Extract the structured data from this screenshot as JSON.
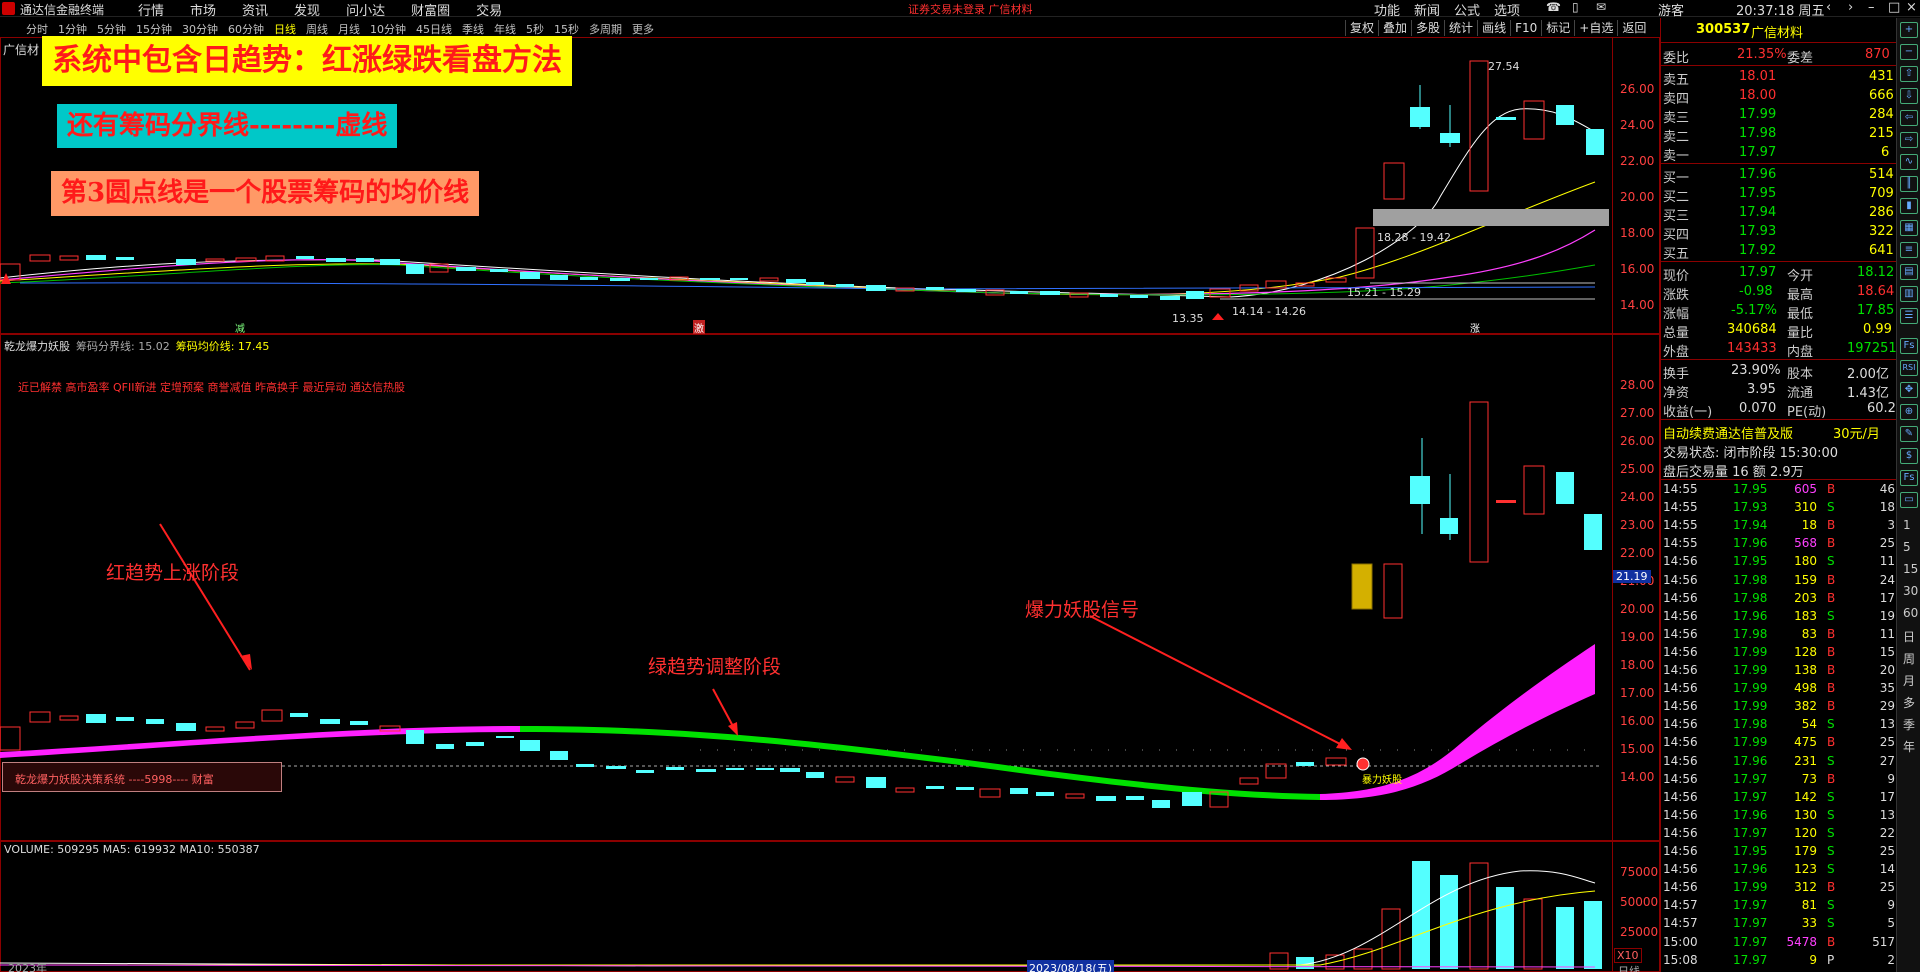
{
  "app": {
    "title": "通达信金融终端",
    "menu": [
      "行情",
      "市场",
      "资讯",
      "发现",
      "问小达",
      "财富圈",
      "交易"
    ],
    "alert": "证券交易未登录  广信材料",
    "right_menu": [
      "功能",
      "新闻",
      "公式",
      "选项"
    ],
    "guest": "游客",
    "clock": "20:37:18 周五"
  },
  "periods": [
    "分时",
    "1分钟",
    "5分钟",
    "15分钟",
    "30分钟",
    "60分钟",
    "日线",
    "周线",
    "月线",
    "10分钟",
    "45日线",
    "季线",
    "年线",
    "5秒",
    "15秒",
    "多周期",
    "更多"
  ],
  "active_period": "日线",
  "tool_buttons": [
    "复权",
    "叠加",
    "多股",
    "统计",
    "画线",
    "F10",
    "标记",
    "+自选",
    "返回"
  ],
  "banners": {
    "b1": "系统中包含日趋势：红涨绿跌看盘方法",
    "b2": "还有筹码分界线--------虚线",
    "b3": "第3圆点线是一个股票筹码的均价线"
  },
  "main_chart": {
    "stock_label": "广信材",
    "y_ticks": [
      "26.00",
      "24.00",
      "22.00",
      "20.00",
      "18.00",
      "16.00",
      "14.00"
    ],
    "high_mark": "27.54",
    "low_mark": "13.35",
    "range1": "18.28 - 19.42",
    "range2": "15.21 - 15.29",
    "range3": "14.14 - 14.26",
    "mark_jian": "减",
    "mark_ji": "激",
    "mark_zhang": "涨"
  },
  "ind_chart": {
    "header_name": "乾龙爆力妖股",
    "header_f1": "筹码分界线: 15.02",
    "header_f2": "筹码均价线: 17.45",
    "tags": "近已解禁 高市盈率 QFII新进 定增预案 商誉减值 昨高换手 最近异动 通达信热股",
    "y_ticks": [
      "28.00",
      "27.00",
      "26.00",
      "25.00",
      "24.00",
      "23.00",
      "22.00",
      "21.00",
      "20.00",
      "19.00",
      "18.00",
      "17.00",
      "16.00",
      "15.00",
      "14.00"
    ],
    "cur_price": "21.19",
    "ann1": "红趋势上涨阶段",
    "ann2": "绿趋势调整阶段",
    "ann3": "爆力妖股信号",
    "signal_label": "暴力妖股",
    "sys_box": "乾龙爆力妖股决策系统    ----5998---- 财富"
  },
  "volume": {
    "header": "VOLUME: 509295  MA5: 619932  MA10: 550387",
    "y_ticks": [
      "75000",
      "50000",
      "25000"
    ],
    "unit": "X10",
    "date_left": "2023年",
    "date_mid": "2023/08/18(五)",
    "date_right": "日线"
  },
  "quote": {
    "code": "300537",
    "name": "广信材料",
    "weibi_label": "委比",
    "weibi": "21.35%",
    "weicha_label": "委差",
    "weicha": "870",
    "asks": [
      {
        "label": "卖五",
        "price": "18.01",
        "vol": "431"
      },
      {
        "label": "卖四",
        "price": "18.00",
        "vol": "666"
      },
      {
        "label": "卖三",
        "price": "17.99",
        "vol": "284"
      },
      {
        "label": "卖二",
        "price": "17.98",
        "vol": "215"
      },
      {
        "label": "卖一",
        "price": "17.97",
        "vol": "6"
      }
    ],
    "bids": [
      {
        "label": "买一",
        "price": "17.96",
        "vol": "514"
      },
      {
        "label": "买二",
        "price": "17.95",
        "vol": "709"
      },
      {
        "label": "买三",
        "price": "17.94",
        "vol": "286"
      },
      {
        "label": "买四",
        "price": "17.93",
        "vol": "322"
      },
      {
        "label": "买五",
        "price": "17.92",
        "vol": "641"
      }
    ],
    "stats": [
      {
        "l1": "现价",
        "v1": "17.97",
        "l2": "今开",
        "v2": "18.12",
        "c1": "#00e000",
        "c2": "#00e000"
      },
      {
        "l1": "涨跌",
        "v1": "-0.98",
        "l2": "最高",
        "v2": "18.64",
        "c1": "#00e000",
        "c2": "#ff3030"
      },
      {
        "l1": "涨幅",
        "v1": "-5.17%",
        "l2": "最低",
        "v2": "17.85",
        "c1": "#00e000",
        "c2": "#00e000"
      },
      {
        "l1": "总量",
        "v1": "340684",
        "l2": "量比",
        "v2": "0.99",
        "c1": "#ffff00",
        "c2": "#ffff00"
      },
      {
        "l1": "外盘",
        "v1": "143433",
        "l2": "内盘",
        "v2": "197251",
        "c1": "#ff3030",
        "c2": "#00e000"
      }
    ],
    "fund": [
      {
        "l1": "换手",
        "v1": "23.90%",
        "l2": "股本",
        "v2": "2.00亿"
      },
      {
        "l1": "净资",
        "v1": "3.95",
        "l2": "流通",
        "v2": "1.43亿"
      },
      {
        "l1": "收益(一)",
        "v1": "0.070",
        "l2": "PE(动)",
        "v2": "60.2"
      }
    ],
    "promo": "自动续费通达信普及版",
    "promo_price": "30元/月",
    "status_line": "交易状态: 闭市阶段 15:30:00",
    "after_line": "盘后交易量 16 额 2.9万"
  },
  "ticks": [
    {
      "t": "14:55",
      "p": "17.95",
      "v": "605",
      "s": "B",
      "n": "46",
      "vc": "#ff40ff"
    },
    {
      "t": "14:55",
      "p": "17.93",
      "v": "310",
      "s": "S",
      "n": "18",
      "vc": "#ffff00"
    },
    {
      "t": "14:55",
      "p": "17.94",
      "v": "18",
      "s": "B",
      "n": "3",
      "vc": "#ffff00"
    },
    {
      "t": "14:55",
      "p": "17.96",
      "v": "568",
      "s": "B",
      "n": "25",
      "vc": "#ff40ff"
    },
    {
      "t": "14:56",
      "p": "17.95",
      "v": "180",
      "s": "S",
      "n": "11",
      "vc": "#ffff00"
    },
    {
      "t": "14:56",
      "p": "17.98",
      "v": "159",
      "s": "B",
      "n": "24",
      "vc": "#ffff00"
    },
    {
      "t": "14:56",
      "p": "17.98",
      "v": "203",
      "s": "B",
      "n": "17",
      "vc": "#ffff00"
    },
    {
      "t": "14:56",
      "p": "17.96",
      "v": "183",
      "s": "S",
      "n": "19",
      "vc": "#ffff00"
    },
    {
      "t": "14:56",
      "p": "17.98",
      "v": "83",
      "s": "B",
      "n": "11",
      "vc": "#ffff00"
    },
    {
      "t": "14:56",
      "p": "17.99",
      "v": "128",
      "s": "B",
      "n": "15",
      "vc": "#ffff00"
    },
    {
      "t": "14:56",
      "p": "17.99",
      "v": "138",
      "s": "B",
      "n": "20",
      "vc": "#ffff00"
    },
    {
      "t": "14:56",
      "p": "17.99",
      "v": "498",
      "s": "B",
      "n": "35",
      "vc": "#ffff00"
    },
    {
      "t": "14:56",
      "p": "17.99",
      "v": "382",
      "s": "B",
      "n": "29",
      "vc": "#ffff00"
    },
    {
      "t": "14:56",
      "p": "17.98",
      "v": "54",
      "s": "S",
      "n": "13",
      "vc": "#ffff00"
    },
    {
      "t": "14:56",
      "p": "17.99",
      "v": "475",
      "s": "B",
      "n": "25",
      "vc": "#ffff00"
    },
    {
      "t": "14:56",
      "p": "17.96",
      "v": "231",
      "s": "S",
      "n": "27",
      "vc": "#ffff00"
    },
    {
      "t": "14:56",
      "p": "17.97",
      "v": "73",
      "s": "B",
      "n": "9",
      "vc": "#ffff00"
    },
    {
      "t": "14:56",
      "p": "17.97",
      "v": "142",
      "s": "S",
      "n": "17",
      "vc": "#ffff00"
    },
    {
      "t": "14:56",
      "p": "17.96",
      "v": "130",
      "s": "S",
      "n": "13",
      "vc": "#ffff00"
    },
    {
      "t": "14:56",
      "p": "17.97",
      "v": "120",
      "s": "S",
      "n": "22",
      "vc": "#ffff00"
    },
    {
      "t": "14:56",
      "p": "17.95",
      "v": "179",
      "s": "S",
      "n": "25",
      "vc": "#ffff00"
    },
    {
      "t": "14:56",
      "p": "17.96",
      "v": "123",
      "s": "S",
      "n": "14",
      "vc": "#ffff00"
    },
    {
      "t": "14:56",
      "p": "17.99",
      "v": "312",
      "s": "B",
      "n": "25",
      "vc": "#ffff00"
    },
    {
      "t": "14:57",
      "p": "17.97",
      "v": "81",
      "s": "S",
      "n": "9",
      "vc": "#ffff00"
    },
    {
      "t": "14:57",
      "p": "17.97",
      "v": "33",
      "s": "S",
      "n": "5",
      "vc": "#ffff00"
    },
    {
      "t": "15:00",
      "p": "17.97",
      "v": "5478",
      "s": "B",
      "n": "517",
      "vc": "#ff40ff"
    },
    {
      "t": "15:08",
      "p": "17.97",
      "v": "9",
      "s": "P",
      "n": "2",
      "vc": "#ffff00"
    }
  ],
  "strip": [
    "Fs",
    "RSI",
    "1",
    "5",
    "15",
    "30",
    "60",
    "日",
    "周",
    "月",
    "多",
    "季",
    "年"
  ]
}
